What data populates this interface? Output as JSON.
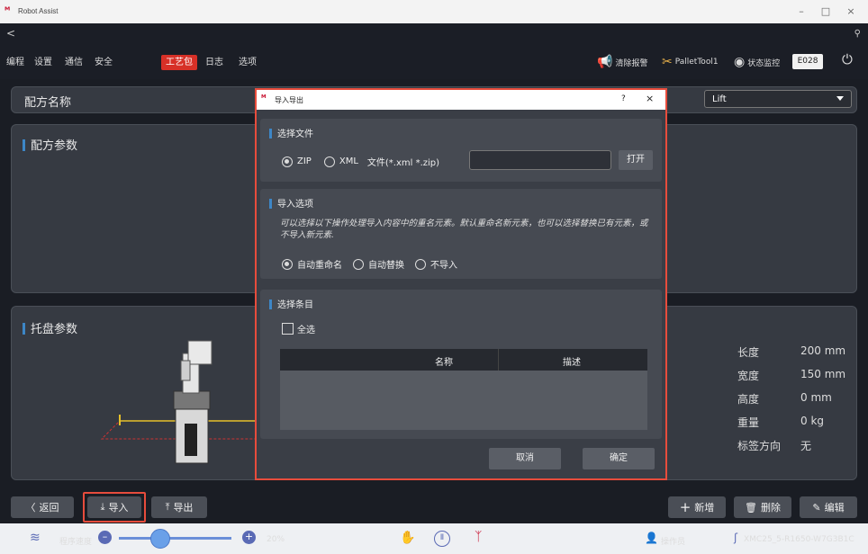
{
  "app": {
    "title": "Robot Assist",
    "logo": "ᴹ"
  },
  "window_controls": {
    "minimize": "–",
    "maximize": "□",
    "close": "×"
  },
  "topbar": {
    "back": "<",
    "search_icon": "⚲"
  },
  "nav": {
    "items": [
      "编程",
      "设置",
      "通信",
      "安全",
      "工艺包",
      "日志",
      "选项"
    ],
    "active": "工艺包"
  },
  "right_tools": {
    "clear_alarm": "清除报警",
    "pallet_tool": "PalletTool1",
    "status_monitor": "状态监控",
    "code": "E028"
  },
  "recipe": {
    "name_label": "配方名称",
    "selected": "Lift",
    "params_label": "配方参数"
  },
  "pallet": {
    "label": "托盘参数",
    "dims": [
      {
        "label": "长度",
        "value": "200 mm"
      },
      {
        "label": "宽度",
        "value": "150 mm"
      },
      {
        "label": "高度",
        "value": "0 mm"
      },
      {
        "label": "重量",
        "value": "0 kg"
      },
      {
        "label": "标签方向",
        "value": "无"
      }
    ]
  },
  "bottom": {
    "back": "返回",
    "import": "导入",
    "export": "导出",
    "add": "新增",
    "delete": "删除",
    "edit": "编辑"
  },
  "status": {
    "speed_label": "程序速度",
    "speed_value": "20%",
    "operator": "操作员",
    "controller": "XMC25_5-R1650-W7G3B1C"
  },
  "dialog": {
    "title": "导入导出",
    "help": "?",
    "close": "×",
    "file_section": "选择文件",
    "zip": "ZIP",
    "xml": "XML",
    "file_type": "文件(*.xml *.zip)",
    "path_value": "",
    "open_button": "打开",
    "import_section": "导入选项",
    "description": "可以选择以下操作处理导入内容中的重名元素。默认重命名新元素，也可以选择替换已有元素，或不导入新元素.",
    "opt_rename": "自动重命名",
    "opt_replace": "自动替换",
    "opt_skip": "不导入",
    "items_section": "选择条目",
    "select_all": "全选",
    "col_name": "名称",
    "col_desc": "描述",
    "cancel": "取消",
    "ok": "确定"
  },
  "colors": {
    "accent": "#d73027",
    "highlight": "#e74c3c",
    "section_bar": "#3d86c6"
  }
}
